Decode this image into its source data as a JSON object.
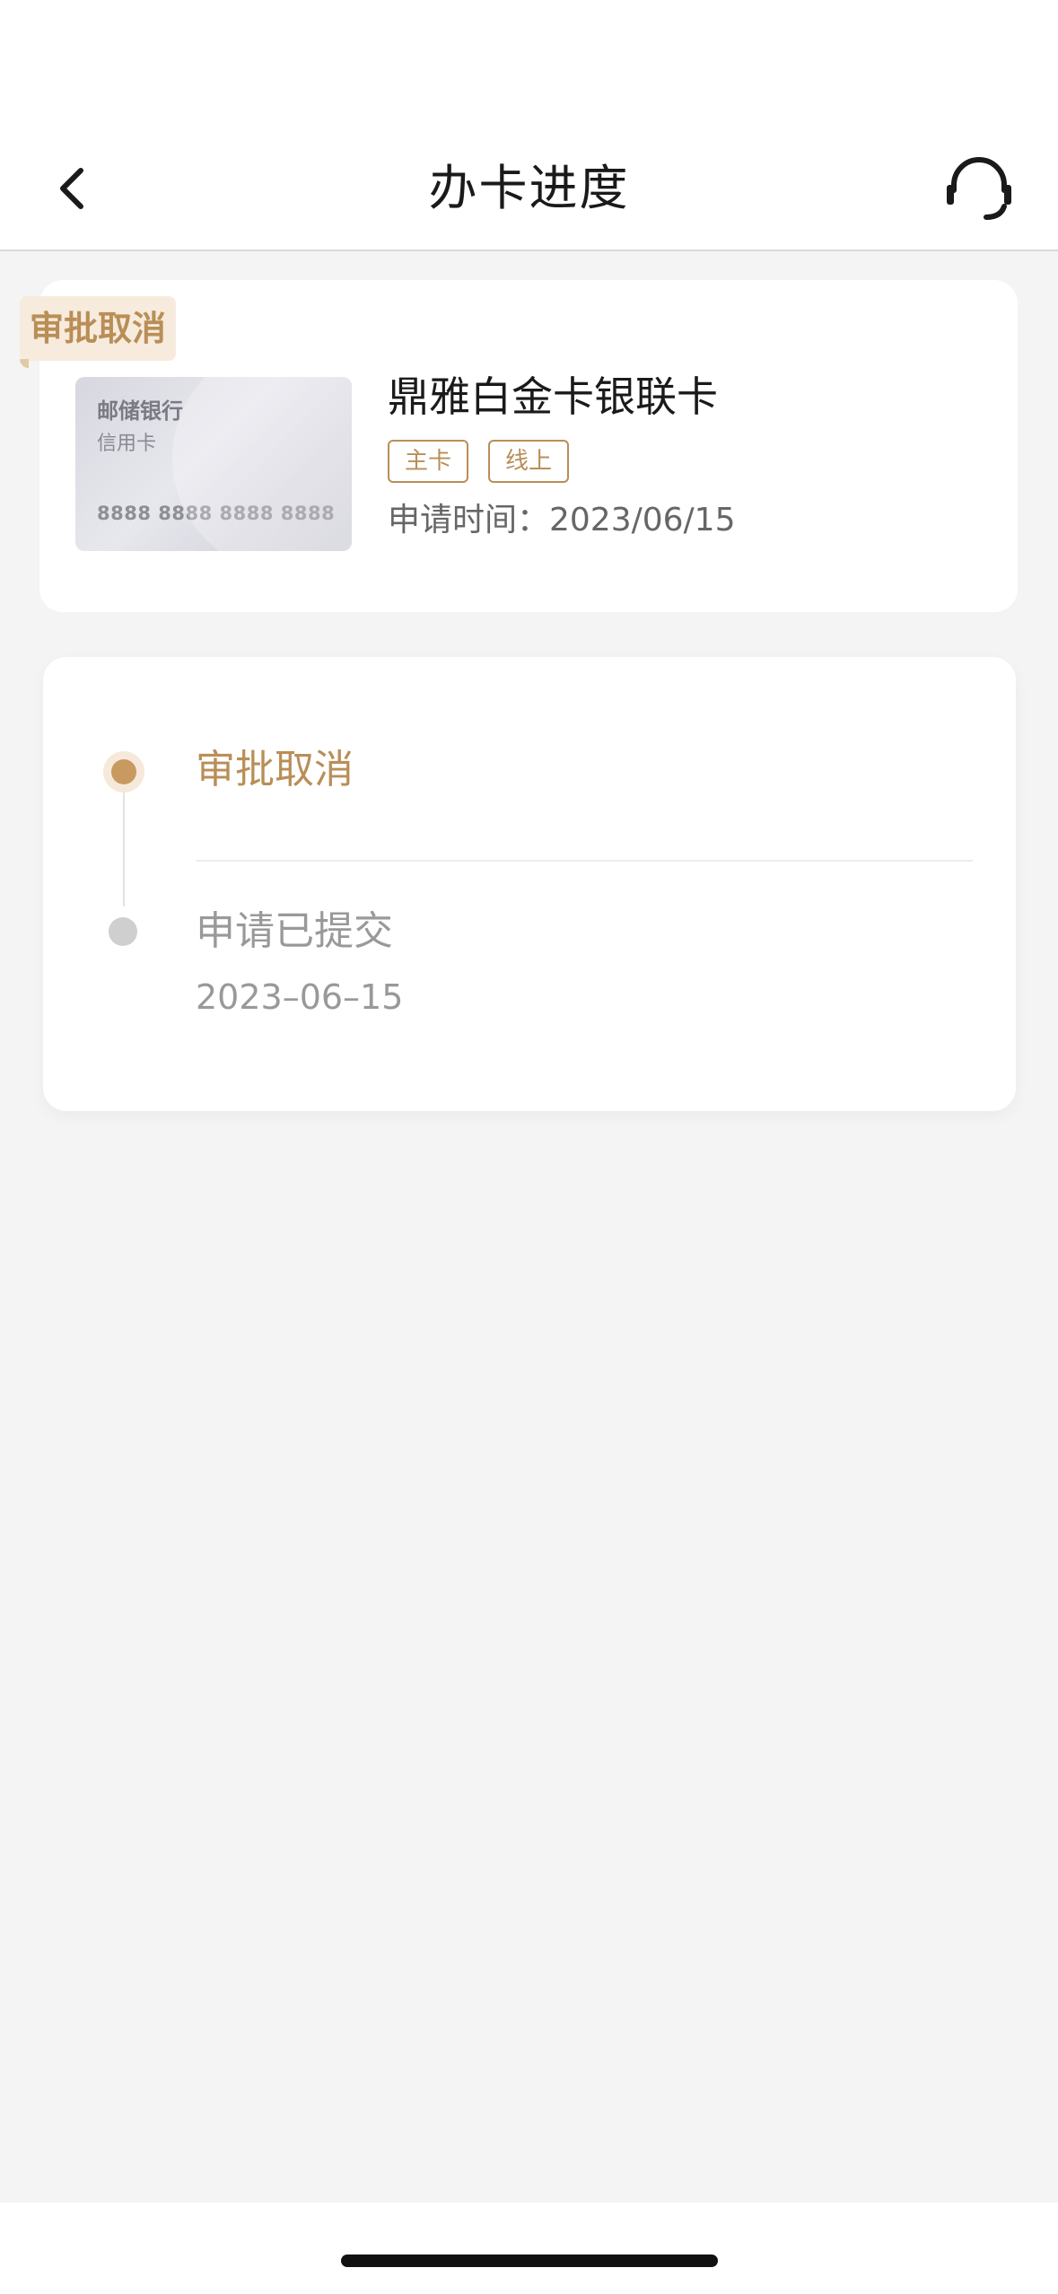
{
  "header": {
    "title": "办卡进度",
    "back_icon": "chevron-left-icon",
    "support_icon": "headset-icon"
  },
  "card": {
    "status_badge": "审批取消",
    "image": {
      "bank": "邮储银行",
      "type": "信用卡",
      "number": "8888 8888 8888 8888"
    },
    "name": "鼎雅白金卡银联卡",
    "tags": [
      "主卡",
      "线上"
    ],
    "apply_time": "申请时间：2023/06/15"
  },
  "timeline": {
    "steps": [
      {
        "title": "审批取消",
        "active": true
      },
      {
        "title": "申请已提交",
        "date": "2023–06–15",
        "active": false
      }
    ]
  },
  "colors": {
    "accent": "#b98e57",
    "background": "#f4f4f4"
  }
}
